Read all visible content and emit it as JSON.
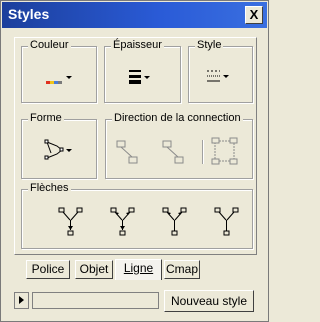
{
  "window": {
    "title": "Styles",
    "close_glyph": "X"
  },
  "groups": {
    "couleur": "Couleur",
    "epaisseur": "Épaisseur",
    "style": "Style",
    "forme": "Forme",
    "direction": "Direction de la connection",
    "fleches": "Flèches"
  },
  "tabs": [
    {
      "label": "Police",
      "active": false
    },
    {
      "label": "Objet",
      "active": false
    },
    {
      "label": "Ligne",
      "active": true
    },
    {
      "label": "Cmap",
      "active": false
    }
  ],
  "bottom": {
    "style_name_value": "",
    "new_style_label": "Nouveau style"
  },
  "icons": {
    "color": "color-dropdown-icon",
    "thickness": "thickness-dropdown-icon",
    "line_style": "line-style-dropdown-icon",
    "shape": "shape-dropdown-icon",
    "arrows": [
      "arrow-style-1-icon",
      "arrow-style-2-icon",
      "arrow-style-3-icon",
      "arrow-style-4-icon"
    ]
  },
  "colors": {
    "title_bar": "#2a5bd7",
    "background": "#ece9d8",
    "accent_red": "#e0301e",
    "accent_yellow": "#f0c419",
    "accent_blue": "#4a7bd8"
  }
}
